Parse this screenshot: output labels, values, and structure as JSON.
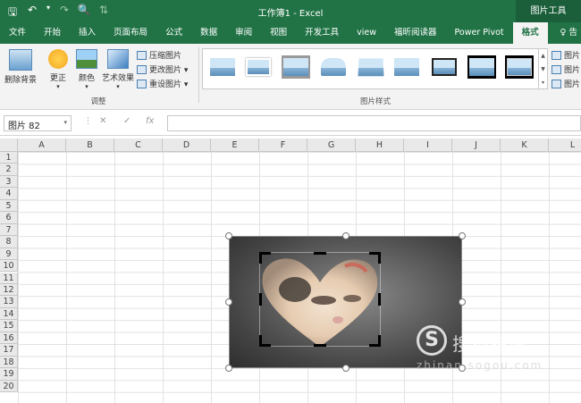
{
  "titlebar": {
    "title": "工作簿1  -  Excel",
    "tool_badge": "图片工具",
    "qat": {
      "save": "🖫",
      "undo": "↶",
      "undo_dd": "▾",
      "redo": "↷",
      "preview": "🔍",
      "sort": "⇅"
    }
  },
  "tabs": [
    "文件",
    "开始",
    "插入",
    "页面布局",
    "公式",
    "数据",
    "审阅",
    "视图",
    "开发工具",
    "view",
    "福昕阅读器",
    "Power Pivot",
    "格式"
  ],
  "tab_tail": "♀ 告",
  "ribbon": {
    "remove_bg": "删除背景",
    "correct": "更正",
    "color": "颜色",
    "artistic": "艺术效果",
    "compress": "压缩图片",
    "change": "更改图片 ▾",
    "reset": "重设图片 ▾",
    "dd": "▾",
    "group_adjust": "调整",
    "group_styles": "图片样式",
    "right_items": [
      "图片",
      "图片",
      "图片"
    ]
  },
  "formula_bar": {
    "name_box": "图片 82",
    "dd": "▾",
    "sep": "⋮",
    "cancel": "✕",
    "enter": "✓",
    "fx": "fx"
  },
  "columns": [
    "A",
    "B",
    "C",
    "D",
    "E",
    "F",
    "G",
    "H",
    "I",
    "J",
    "K",
    "L"
  ],
  "rows": [
    "1",
    "2",
    "3",
    "4",
    "5",
    "6",
    "7",
    "8",
    "9",
    "10",
    "11",
    "12",
    "13",
    "14",
    "15",
    "16",
    "17",
    "18",
    "19",
    "20"
  ],
  "watermark": {
    "logo": "S",
    "text": "搜狗指南",
    "url": "zhinan.sogou.com"
  },
  "colors": {
    "excel_green": "#217346",
    "ribbon_bg": "#f3f3f3"
  }
}
